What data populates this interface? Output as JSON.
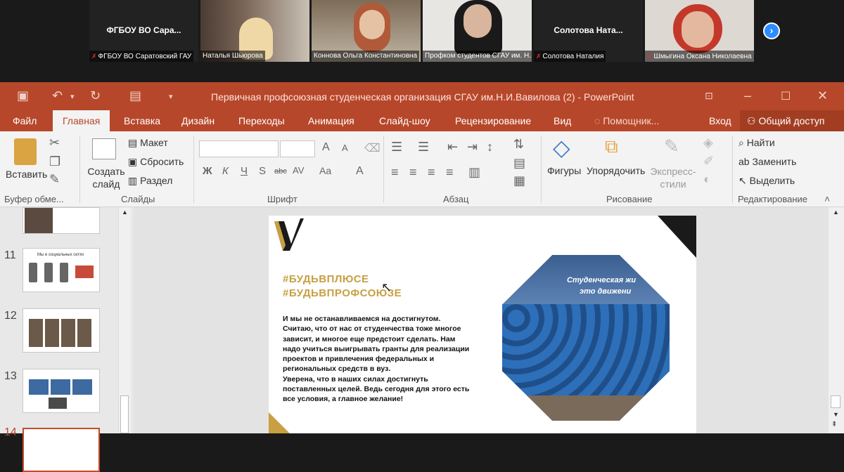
{
  "zoom": {
    "tiles": [
      {
        "name_big": "ФГБОУ ВО Сара...",
        "caption": "ФГБОУ ВО Саратовский ГАУ",
        "muted": true
      },
      {
        "caption": "Наталья Шьюрова",
        "muted": false
      },
      {
        "caption": "Коннова Ольга Константиновна",
        "muted": false
      },
      {
        "caption": "Профком студентов СГАУ им. Н...",
        "muted": false
      },
      {
        "name_big": "Солотова  Ната...",
        "caption": "Солотова Наталия",
        "muted": true
      },
      {
        "caption": "Шмыгина Оксана Николаевна",
        "muted": true
      }
    ],
    "next_icon": "chevron-right-icon"
  },
  "window": {
    "title": "Первичная профсоюзная студенческая организация СГАУ им.Н.И.Вавилова (2) - PowerPoint"
  },
  "tabs": [
    "Файл",
    "Главная",
    "Вставка",
    "Дизайн",
    "Переходы",
    "Анимация",
    "Слайд-шоу",
    "Рецензирование",
    "Вид",
    "Помощник..."
  ],
  "signin": "Вход",
  "share": "Общий доступ",
  "ribbon": {
    "paste": "Вставить",
    "create_slide": "Создать слайд",
    "layout": "Макет",
    "reset": "Сбросить",
    "section": "Раздел",
    "shapes": "Фигуры",
    "arrange": "Упорядочить",
    "express": "Экспресс-стили",
    "find": "Найти",
    "replace": "Заменить",
    "select": "Выделить",
    "groups": {
      "clipboard": "Буфер обме...",
      "slides": "Слайды",
      "font": "Шрифт",
      "paragraph": "Абзац",
      "drawing": "Рисование",
      "editing": "Редактирование"
    }
  },
  "thumbnails": [
    {
      "num": "11",
      "title": "Мы в социальных сетях"
    },
    {
      "num": "12"
    },
    {
      "num": "13"
    },
    {
      "num": "14"
    }
  ],
  "slide": {
    "hashtag1": "#БУДЬВПЛЮСЕ",
    "hashtag2": "#БУДЬВПРОФСОЮЗЕ",
    "body_lines": [
      " И мы не останавливаемся на достигнутом.",
      "Считаю, что от нас от студенчества тоже многое",
      "зависит, и многое еще предстоит сделать. Нам",
      "надо учиться выигрывать гранты для реализации",
      "проектов и привлечения федеральных и",
      "региональных средств в вуз.",
      " Уверена, что в наших силах достигнуть",
      "поставленных целей. Ведь сегодня для этого есть",
      "все условия, а главное желание!"
    ],
    "banner_line1": "Студенческая жи",
    "banner_line2": "это движени"
  },
  "colors": {
    "accent": "#b7472a",
    "gold": "#c8a042"
  }
}
